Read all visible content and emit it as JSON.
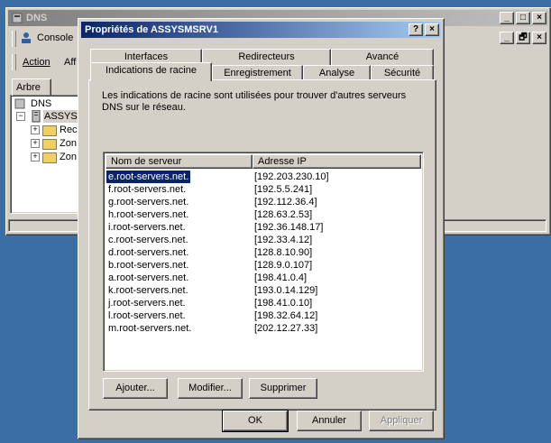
{
  "mmc": {
    "title": "DNS",
    "menu": {
      "console": "Console",
      "action": "Action",
      "affichage": "Aff"
    },
    "tab_arbre": "Arbre",
    "tree": {
      "root": "DNS",
      "server": "ASSYSM",
      "children": [
        "Rec",
        "Zon",
        "Zon"
      ]
    },
    "caption_buttons": [
      "_",
      "□",
      "×"
    ],
    "child_caption_buttons": [
      "_",
      "🗗",
      "×"
    ]
  },
  "dialog": {
    "title": "Propriétés de ASSYSMSRV1",
    "help_button": "?",
    "close_button": "×",
    "tabs_top": [
      "Interfaces",
      "Redirecteurs",
      "Avancé"
    ],
    "tabs_bottom": [
      "Indications de racine",
      "Enregistrement",
      "Analyse",
      "Sécurité"
    ],
    "description": "Les indications de racine sont utilisées pour trouver d'autres serveurs DNS sur le réseau.",
    "list": {
      "headers": [
        "Nom de serveur",
        "Adresse IP"
      ],
      "rows": [
        {
          "name": "e.root-servers.net.",
          "ip": "[192.203.230.10]"
        },
        {
          "name": "f.root-servers.net.",
          "ip": "[192.5.5.241]"
        },
        {
          "name": "g.root-servers.net.",
          "ip": "[192.112.36.4]"
        },
        {
          "name": "h.root-servers.net.",
          "ip": "[128.63.2.53]"
        },
        {
          "name": "i.root-servers.net.",
          "ip": "[192.36.148.17]"
        },
        {
          "name": "c.root-servers.net.",
          "ip": "[192.33.4.12]"
        },
        {
          "name": "d.root-servers.net.",
          "ip": "[128.8.10.90]"
        },
        {
          "name": "b.root-servers.net.",
          "ip": "[128.9.0.107]"
        },
        {
          "name": "a.root-servers.net.",
          "ip": "[198.41.0.4]"
        },
        {
          "name": "k.root-servers.net.",
          "ip": "[193.0.14.129]"
        },
        {
          "name": "j.root-servers.net.",
          "ip": "[198.41.0.10]"
        },
        {
          "name": "l.root-servers.net.",
          "ip": "[198.32.64.12]"
        },
        {
          "name": "m.root-servers.net.",
          "ip": "[202.12.27.33]"
        }
      ]
    },
    "buttons": {
      "add": "Ajouter...",
      "edit": "Modifier...",
      "delete": "Supprimer"
    },
    "footer": {
      "ok": "OK",
      "cancel": "Annuler",
      "apply": "Appliquer"
    }
  }
}
